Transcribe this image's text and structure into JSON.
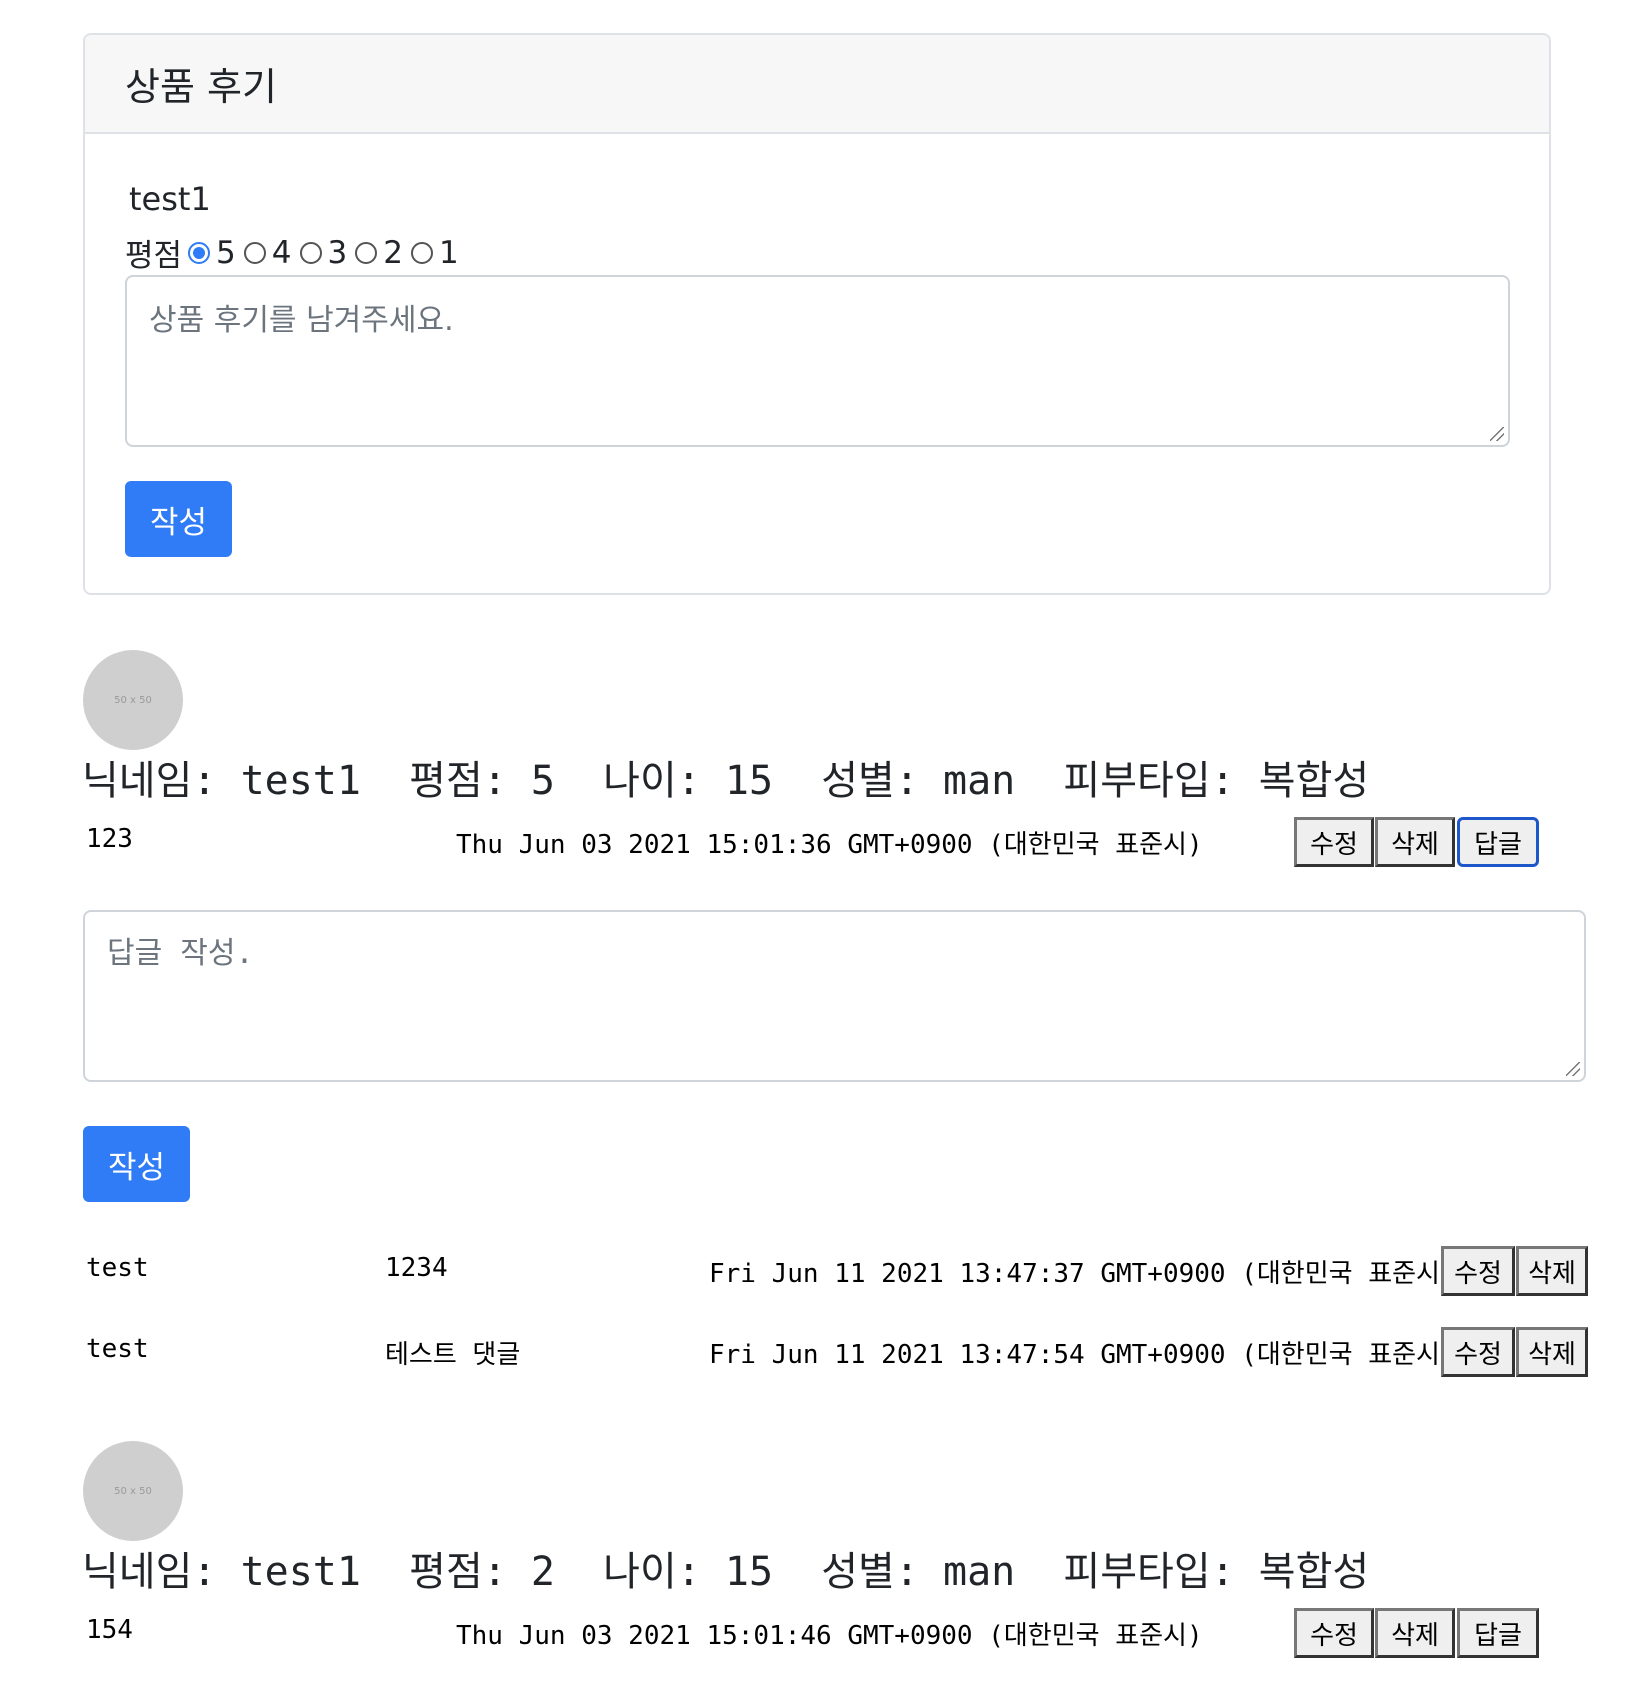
{
  "form": {
    "title": "상품 후기",
    "user": "test1",
    "rating_label": "평점",
    "rating_options": [
      "5",
      "4",
      "3",
      "2",
      "1"
    ],
    "rating_selected": "5",
    "placeholder": "상품 후기를 남겨주세요.",
    "submit_label": "작성"
  },
  "avatar_placeholder": "50 x 50",
  "reviews": [
    {
      "meta": "닉네임: test1  평점: 5  나이: 15  성별: man  피부타입: 복합성",
      "content": "123",
      "date": "Thu Jun 03 2021 15:01:36 GMT+0900 (대한민국 표준시)",
      "edit_label": "수정",
      "delete_label": "삭제",
      "reply_label": "답글"
    },
    {
      "meta": "닉네임: test1  평점: 2  나이: 15  성별: man  피부타입: 복합성",
      "content": "154",
      "date": "Thu Jun 03 2021 15:01:46 GMT+0900 (대한민국 표준시)",
      "edit_label": "수정",
      "delete_label": "삭제",
      "reply_label": "답글"
    }
  ],
  "reply_form": {
    "placeholder": "답글 작성.",
    "submit_label": "작성"
  },
  "replies": [
    {
      "user": "test",
      "content": "1234",
      "date": "Fri Jun 11 2021 13:47:37 GMT+0900 (대한민국 표준시)",
      "edit_label": "수정",
      "delete_label": "삭제"
    },
    {
      "user": "test",
      "content": "테스트 댓글",
      "date": "Fri Jun 11 2021 13:47:54 GMT+0900 (대한민국 표준시)",
      "edit_label": "수정",
      "delete_label": "삭제"
    }
  ]
}
